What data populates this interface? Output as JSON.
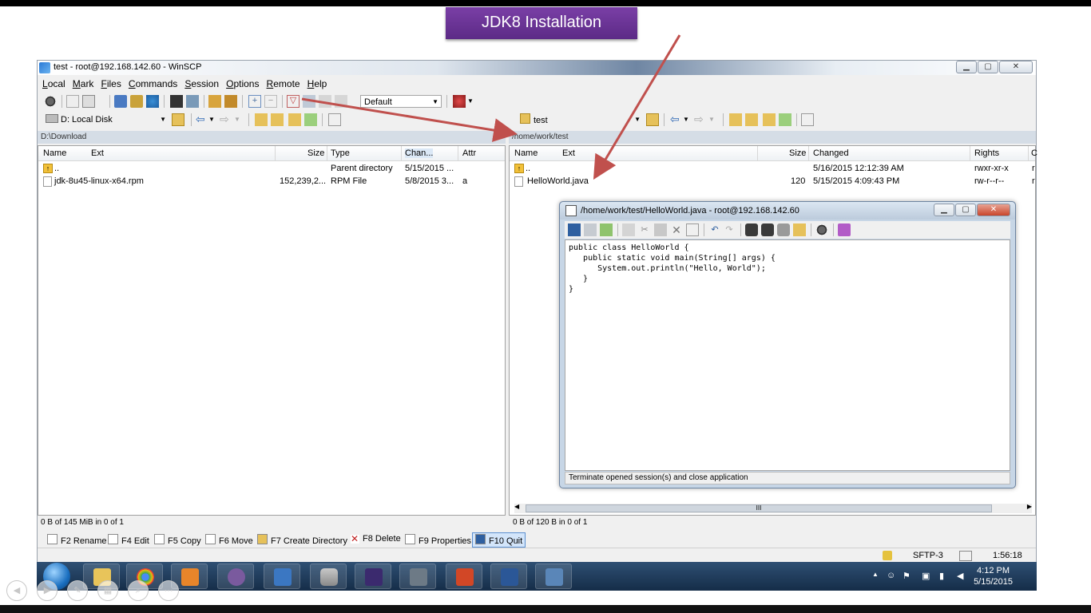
{
  "slide": {
    "title": "JDK8 Installation"
  },
  "window": {
    "title": "test - root@192.168.142.60 - WinSCP",
    "controls": {
      "minimize": "▁",
      "maximize": "▢",
      "close": "✕"
    }
  },
  "menu": [
    "Local",
    "Mark",
    "Files",
    "Commands",
    "Session",
    "Options",
    "Remote",
    "Help"
  ],
  "toolbar": {
    "transfer_profile": "Default"
  },
  "left": {
    "drive": "D: Local Disk",
    "path": "D:\\Download",
    "columns": [
      "Name",
      "Ext",
      "Size",
      "Type",
      "Chan...",
      "Attr"
    ],
    "rows": [
      {
        "name": "..",
        "size": "",
        "type": "Parent directory",
        "changed": "5/15/2015  ...",
        "attr": ""
      },
      {
        "name": "jdk-8u45-linux-x64.rpm",
        "size": "152,239,2...",
        "type": "RPM File",
        "changed": "5/8/2015  3...",
        "attr": "a"
      }
    ],
    "status": "0 B of 145 MiB in 0 of 1"
  },
  "right": {
    "drive": "test",
    "path": "/home/work/test",
    "columns": [
      "Name",
      "Ext",
      "Size",
      "Changed",
      "Rights",
      "C"
    ],
    "rows": [
      {
        "name": "..",
        "size": "",
        "changed": "5/16/2015 12:12:39 AM",
        "rights": "rwxr-xr-x",
        "owner": "r"
      },
      {
        "name": "HelloWorld.java",
        "size": "120",
        "changed": "5/15/2015 4:09:43 PM",
        "rights": "rw-r--r--",
        "owner": "r"
      }
    ],
    "status": "0 B of 120 B in 0 of 1",
    "hscroll_label": "III"
  },
  "fkeys": [
    "F2 Rename",
    "F4 Edit",
    "F5 Copy",
    "F6 Move",
    "F7 Create Directory",
    "F8 Delete",
    "F9 Properties",
    "F10 Quit"
  ],
  "statusbar": {
    "protocol": "SFTP-3",
    "elapsed": "1:56:18"
  },
  "editor": {
    "title": "/home/work/test/HelloWorld.java - root@192.168.142.60",
    "code": "public class HelloWorld {\n   public static void main(String[] args) {\n      System.out.println(\"Hello, World\");\n   }\n}",
    "status": "Terminate opened session(s) and close application"
  },
  "taskbar": {
    "time": "4:12 PM",
    "date": "5/15/2015",
    "apps": [
      "windows-explorer",
      "chrome",
      "outlook",
      "pidgin",
      "text-editor",
      "database-app",
      "java-ee-ide",
      "vpn-lock",
      "powerpoint",
      "word",
      "remote-desktop"
    ]
  },
  "colors": {
    "banner": "#6a3398",
    "arrow": "#c0504d",
    "taskbar": "#1f3b5c"
  }
}
